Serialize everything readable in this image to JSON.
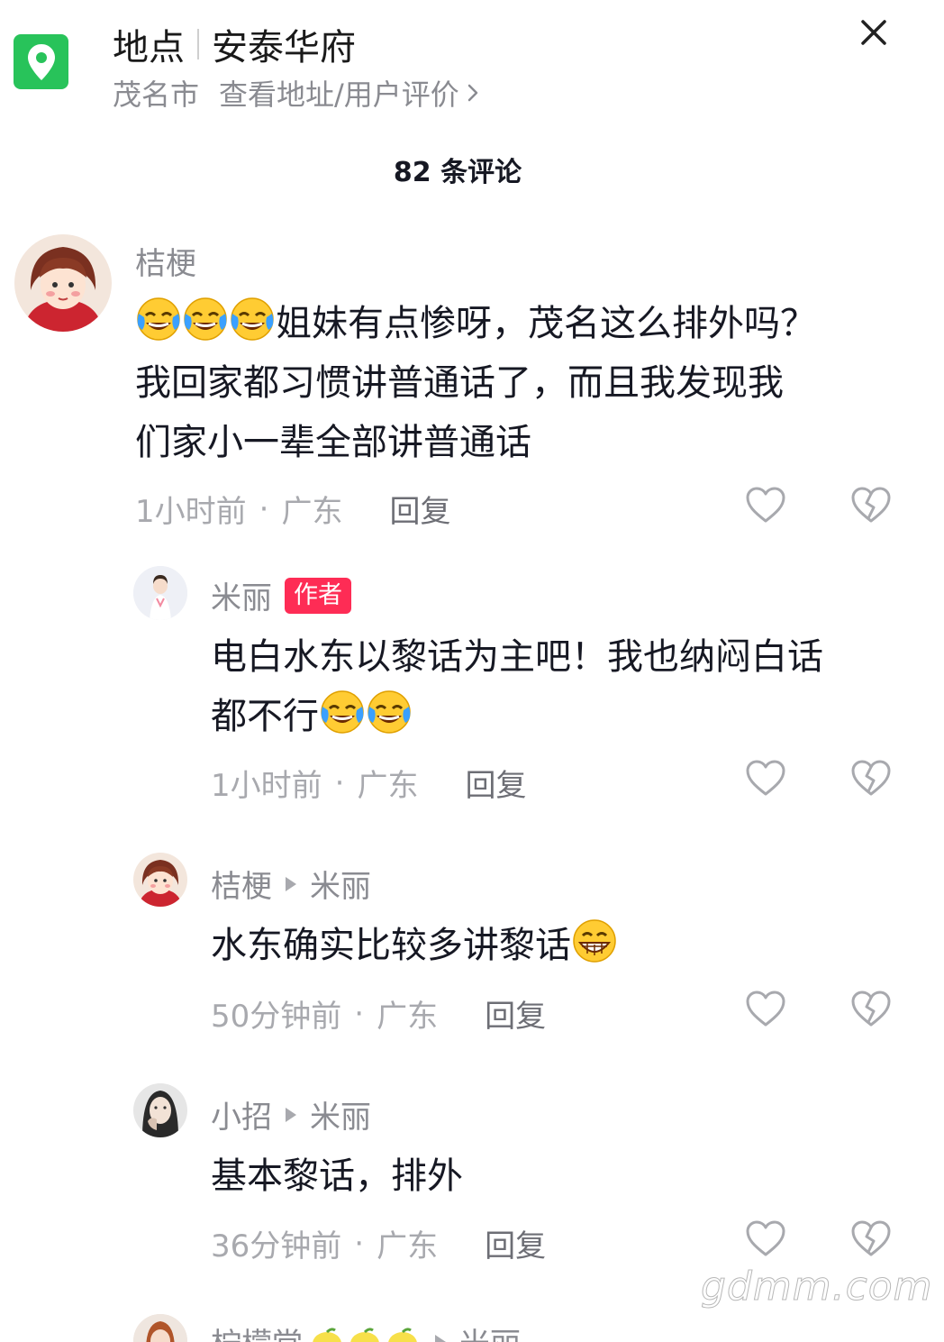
{
  "header": {
    "location_label": "地点",
    "location_name": "安泰华府",
    "city": "茂名市",
    "details_link": "查看地址/用户评价"
  },
  "comment_count": "82 条评论",
  "comments": [
    {
      "name": "桔梗",
      "text_1": "姐妹有点惨呀，茂名这么排外吗？",
      "text_2": "我回家都习惯讲普通话了，而且我发现我",
      "text_3": "们家小一辈全部讲普通话",
      "time": "1小时前",
      "region": "广东",
      "reply": "回复"
    },
    {
      "name": "米丽",
      "tag": "作者",
      "text_1": "电白水东以黎话为主吧！我也纳闷白话",
      "text_2": "都不行",
      "time": "1小时前",
      "region": "广东",
      "reply": "回复"
    },
    {
      "name": "桔梗",
      "reply_to": "米丽",
      "text_1": "水东确实比较多讲黎话",
      "time": "50分钟前",
      "region": "广东",
      "reply": "回复"
    },
    {
      "name": "小招",
      "reply_to": "米丽",
      "text_1": "基本黎话，排外",
      "time": "36分钟前",
      "region": "广东",
      "reply": "回复"
    }
  ],
  "partial_comment": {
    "name": "柠檬堂",
    "reply_to": "米丽"
  },
  "watermark": "gdmm.com",
  "colors": {
    "pin_green": "#28c35a",
    "author_tag": "#fe2c55",
    "secondary_text": "#8a8b91"
  }
}
